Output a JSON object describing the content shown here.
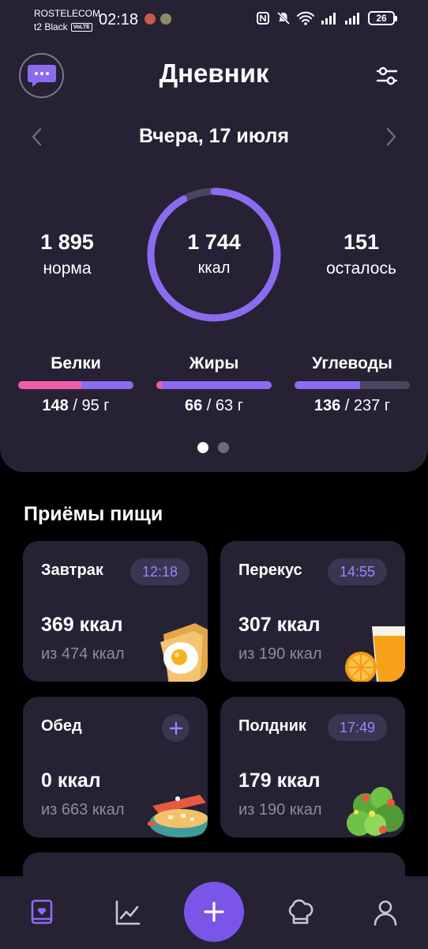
{
  "status_bar": {
    "carrier_line1": "ROSTELECOM",
    "carrier_line2": "t2 Black",
    "volte": "VoLTE",
    "time": "02:18",
    "battery": "26"
  },
  "header": {
    "title": "Дневник",
    "date": "Вчера,  17 июля"
  },
  "calories": {
    "norm_value": "1 895",
    "norm_label": "норма",
    "eaten_value": "1 744",
    "eaten_unit": "ккал",
    "left_value": "151",
    "left_label": "осталось",
    "progress": 0.92
  },
  "macros": [
    {
      "label": "Белки",
      "eaten": "148",
      "target": " / 95 г",
      "fill": 1.0,
      "overflow_fraction": 0.55,
      "color": "#ef5da8",
      "extra_color": "#8b6cf0"
    },
    {
      "label": "Жиры",
      "eaten": "66",
      "target": " / 63 г",
      "fill": 1.0,
      "overflow_fraction": 0.05,
      "color": "#ef5da8",
      "extra_color": "#8b6cf0"
    },
    {
      "label": "Углеводы",
      "eaten": "136",
      "target": " / 237 г",
      "fill": 0.57,
      "color": "#8b6cf0"
    }
  ],
  "meals": {
    "title": "Приёмы пищи",
    "items": [
      {
        "name": "Завтрак",
        "time": "12:18",
        "kcal": "369 ккал",
        "goal": "из 474 ккал"
      },
      {
        "name": "Перекус",
        "time": "14:55",
        "kcal": "307 ккал",
        "goal": "из 190 ккал"
      },
      {
        "name": "Обед",
        "time": "",
        "kcal": "0 ккал",
        "goal": "из 663 ккал"
      },
      {
        "name": "Полдник",
        "time": "17:49",
        "kcal": "179 ккал",
        "goal": "из 190 ккал"
      }
    ]
  },
  "colors": {
    "accent": "#7a55e8",
    "ring": "#8b6cf0",
    "panel": "#262234",
    "background": "#000000"
  },
  "nav": {
    "items": [
      "diary-icon",
      "stats-icon",
      "add-icon",
      "recipes-icon",
      "profile-icon"
    ]
  }
}
